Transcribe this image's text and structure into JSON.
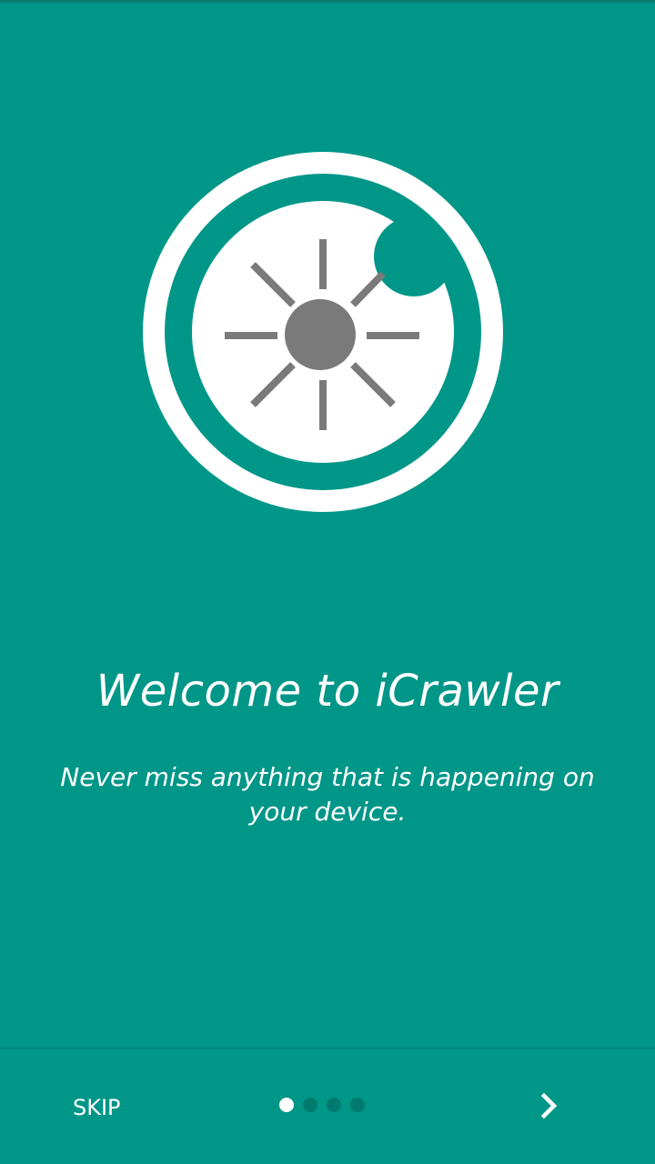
{
  "colors": {
    "background": "#009688",
    "foreground": "#ffffff",
    "inactive_dot": "#007a6e",
    "logo_gray": "#7a7a7a"
  },
  "logo": {
    "icon": "eye-sun-logo-icon"
  },
  "intro": {
    "title": "Welcome to iCrawler",
    "subtitle": "Never miss anything that is happening on your device."
  },
  "footer": {
    "skip_label": "SKIP",
    "next_icon": "chevron-right-icon",
    "pager": {
      "total_pages": 4,
      "current_page": 1
    }
  }
}
